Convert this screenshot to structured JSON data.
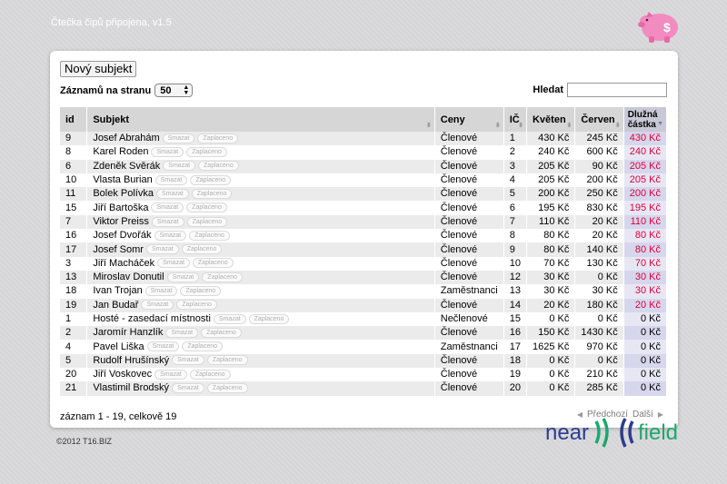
{
  "app": {
    "title": "Čtečka čipů připojena, v1.5"
  },
  "icons": {
    "logo": "piggy-bank-icon",
    "sort": "sort-arrows-icon",
    "prev": "triangle-left-icon",
    "next": "triangle-right-icon"
  },
  "colors": {
    "accent_pink": "#f28bbf",
    "debt_red": "#e0003a",
    "nfc_blue": "#2a3d8f",
    "nfc_green": "#1ea86b"
  },
  "toolbar": {
    "new_subject_label": "Nový subjekt"
  },
  "paging": {
    "per_page_label": "Záznamů na stranu",
    "per_page_value": "50"
  },
  "search": {
    "label": "Hledat",
    "value": ""
  },
  "table": {
    "headers": {
      "id": "id",
      "subject": "Subjekt",
      "price": "Ceny",
      "ic": "IČ",
      "may": "Květen",
      "june": "Červen",
      "debt_line1": "Dlužná",
      "debt_line2": "částka"
    },
    "action_labels": {
      "delete": "Smazat",
      "paid": "Zaplaceno"
    },
    "rows": [
      {
        "id": "9",
        "name": "Josef Abrahám",
        "price": "Členové",
        "ic": "1",
        "may": "430 Kč",
        "june": "245 Kč",
        "debt": "430 Kč"
      },
      {
        "id": "8",
        "name": "Karel Roden",
        "price": "Členové",
        "ic": "2",
        "may": "240 Kč",
        "june": "600 Kč",
        "debt": "240 Kč"
      },
      {
        "id": "6",
        "name": "Zdeněk Svěrák",
        "price": "Členové",
        "ic": "3",
        "may": "205 Kč",
        "june": "90 Kč",
        "debt": "205 Kč"
      },
      {
        "id": "10",
        "name": "Vlasta Burian",
        "price": "Členové",
        "ic": "4",
        "may": "205 Kč",
        "june": "200 Kč",
        "debt": "205 Kč"
      },
      {
        "id": "11",
        "name": "Bolek Polívka",
        "price": "Členové",
        "ic": "5",
        "may": "200 Kč",
        "june": "250 Kč",
        "debt": "200 Kč"
      },
      {
        "id": "15",
        "name": "Jiří Bartoška",
        "price": "Členové",
        "ic": "6",
        "may": "195 Kč",
        "june": "830 Kč",
        "debt": "195 Kč"
      },
      {
        "id": "7",
        "name": "Viktor Preiss",
        "price": "Členové",
        "ic": "7",
        "may": "110 Kč",
        "june": "20 Kč",
        "debt": "110 Kč"
      },
      {
        "id": "16",
        "name": "Josef Dvořák",
        "price": "Členové",
        "ic": "8",
        "may": "80 Kč",
        "june": "20 Kč",
        "debt": "80 Kč"
      },
      {
        "id": "17",
        "name": "Josef Somr",
        "price": "Členové",
        "ic": "9",
        "may": "80 Kč",
        "june": "140 Kč",
        "debt": "80 Kč"
      },
      {
        "id": "3",
        "name": "Jiří Macháček",
        "price": "Členové",
        "ic": "10",
        "may": "70 Kč",
        "june": "130 Kč",
        "debt": "70 Kč"
      },
      {
        "id": "13",
        "name": "Miroslav Donutil",
        "price": "Členové",
        "ic": "12",
        "may": "30 Kč",
        "june": "0 Kč",
        "debt": "30 Kč"
      },
      {
        "id": "18",
        "name": "Ivan Trojan",
        "price": "Zaměstnanci",
        "ic": "13",
        "may": "30 Kč",
        "june": "30 Kč",
        "debt": "30 Kč"
      },
      {
        "id": "19",
        "name": "Jan Budař",
        "price": "Členové",
        "ic": "14",
        "may": "20 Kč",
        "june": "180 Kč",
        "debt": "20 Kč"
      },
      {
        "id": "1",
        "name": "Hosté - zasedací místnosti",
        "price": "Nečlenové",
        "ic": "15",
        "may": "0 Kč",
        "june": "0 Kč",
        "debt": "0 Kč"
      },
      {
        "id": "2",
        "name": "Jaromír Hanzlík",
        "price": "Členové",
        "ic": "16",
        "may": "150 Kč",
        "june": "1430 Kč",
        "debt": "0 Kč"
      },
      {
        "id": "4",
        "name": "Pavel Liška",
        "price": "Zaměstnanci",
        "ic": "17",
        "may": "1625 Kč",
        "june": "970 Kč",
        "debt": "0 Kč"
      },
      {
        "id": "5",
        "name": "Rudolf Hrušínský",
        "price": "Členové",
        "ic": "18",
        "may": "0 Kč",
        "june": "0 Kč",
        "debt": "0 Kč"
      },
      {
        "id": "20",
        "name": "Jiří Voskovec",
        "price": "Členové",
        "ic": "19",
        "may": "0 Kč",
        "june": "210 Kč",
        "debt": "0 Kč"
      },
      {
        "id": "21",
        "name": "Vlastimil Brodský",
        "price": "Členové",
        "ic": "20",
        "may": "0 Kč",
        "june": "285 Kč",
        "debt": "0 Kč"
      }
    ]
  },
  "footer": {
    "info": "záznam 1 - 19, celkově 19",
    "prev_label": "Předchozí",
    "next_label": "Další",
    "copyright": "©2012 T16.BIZ"
  },
  "branding": {
    "nfc_word1": "near",
    "nfc_word2": "field"
  }
}
